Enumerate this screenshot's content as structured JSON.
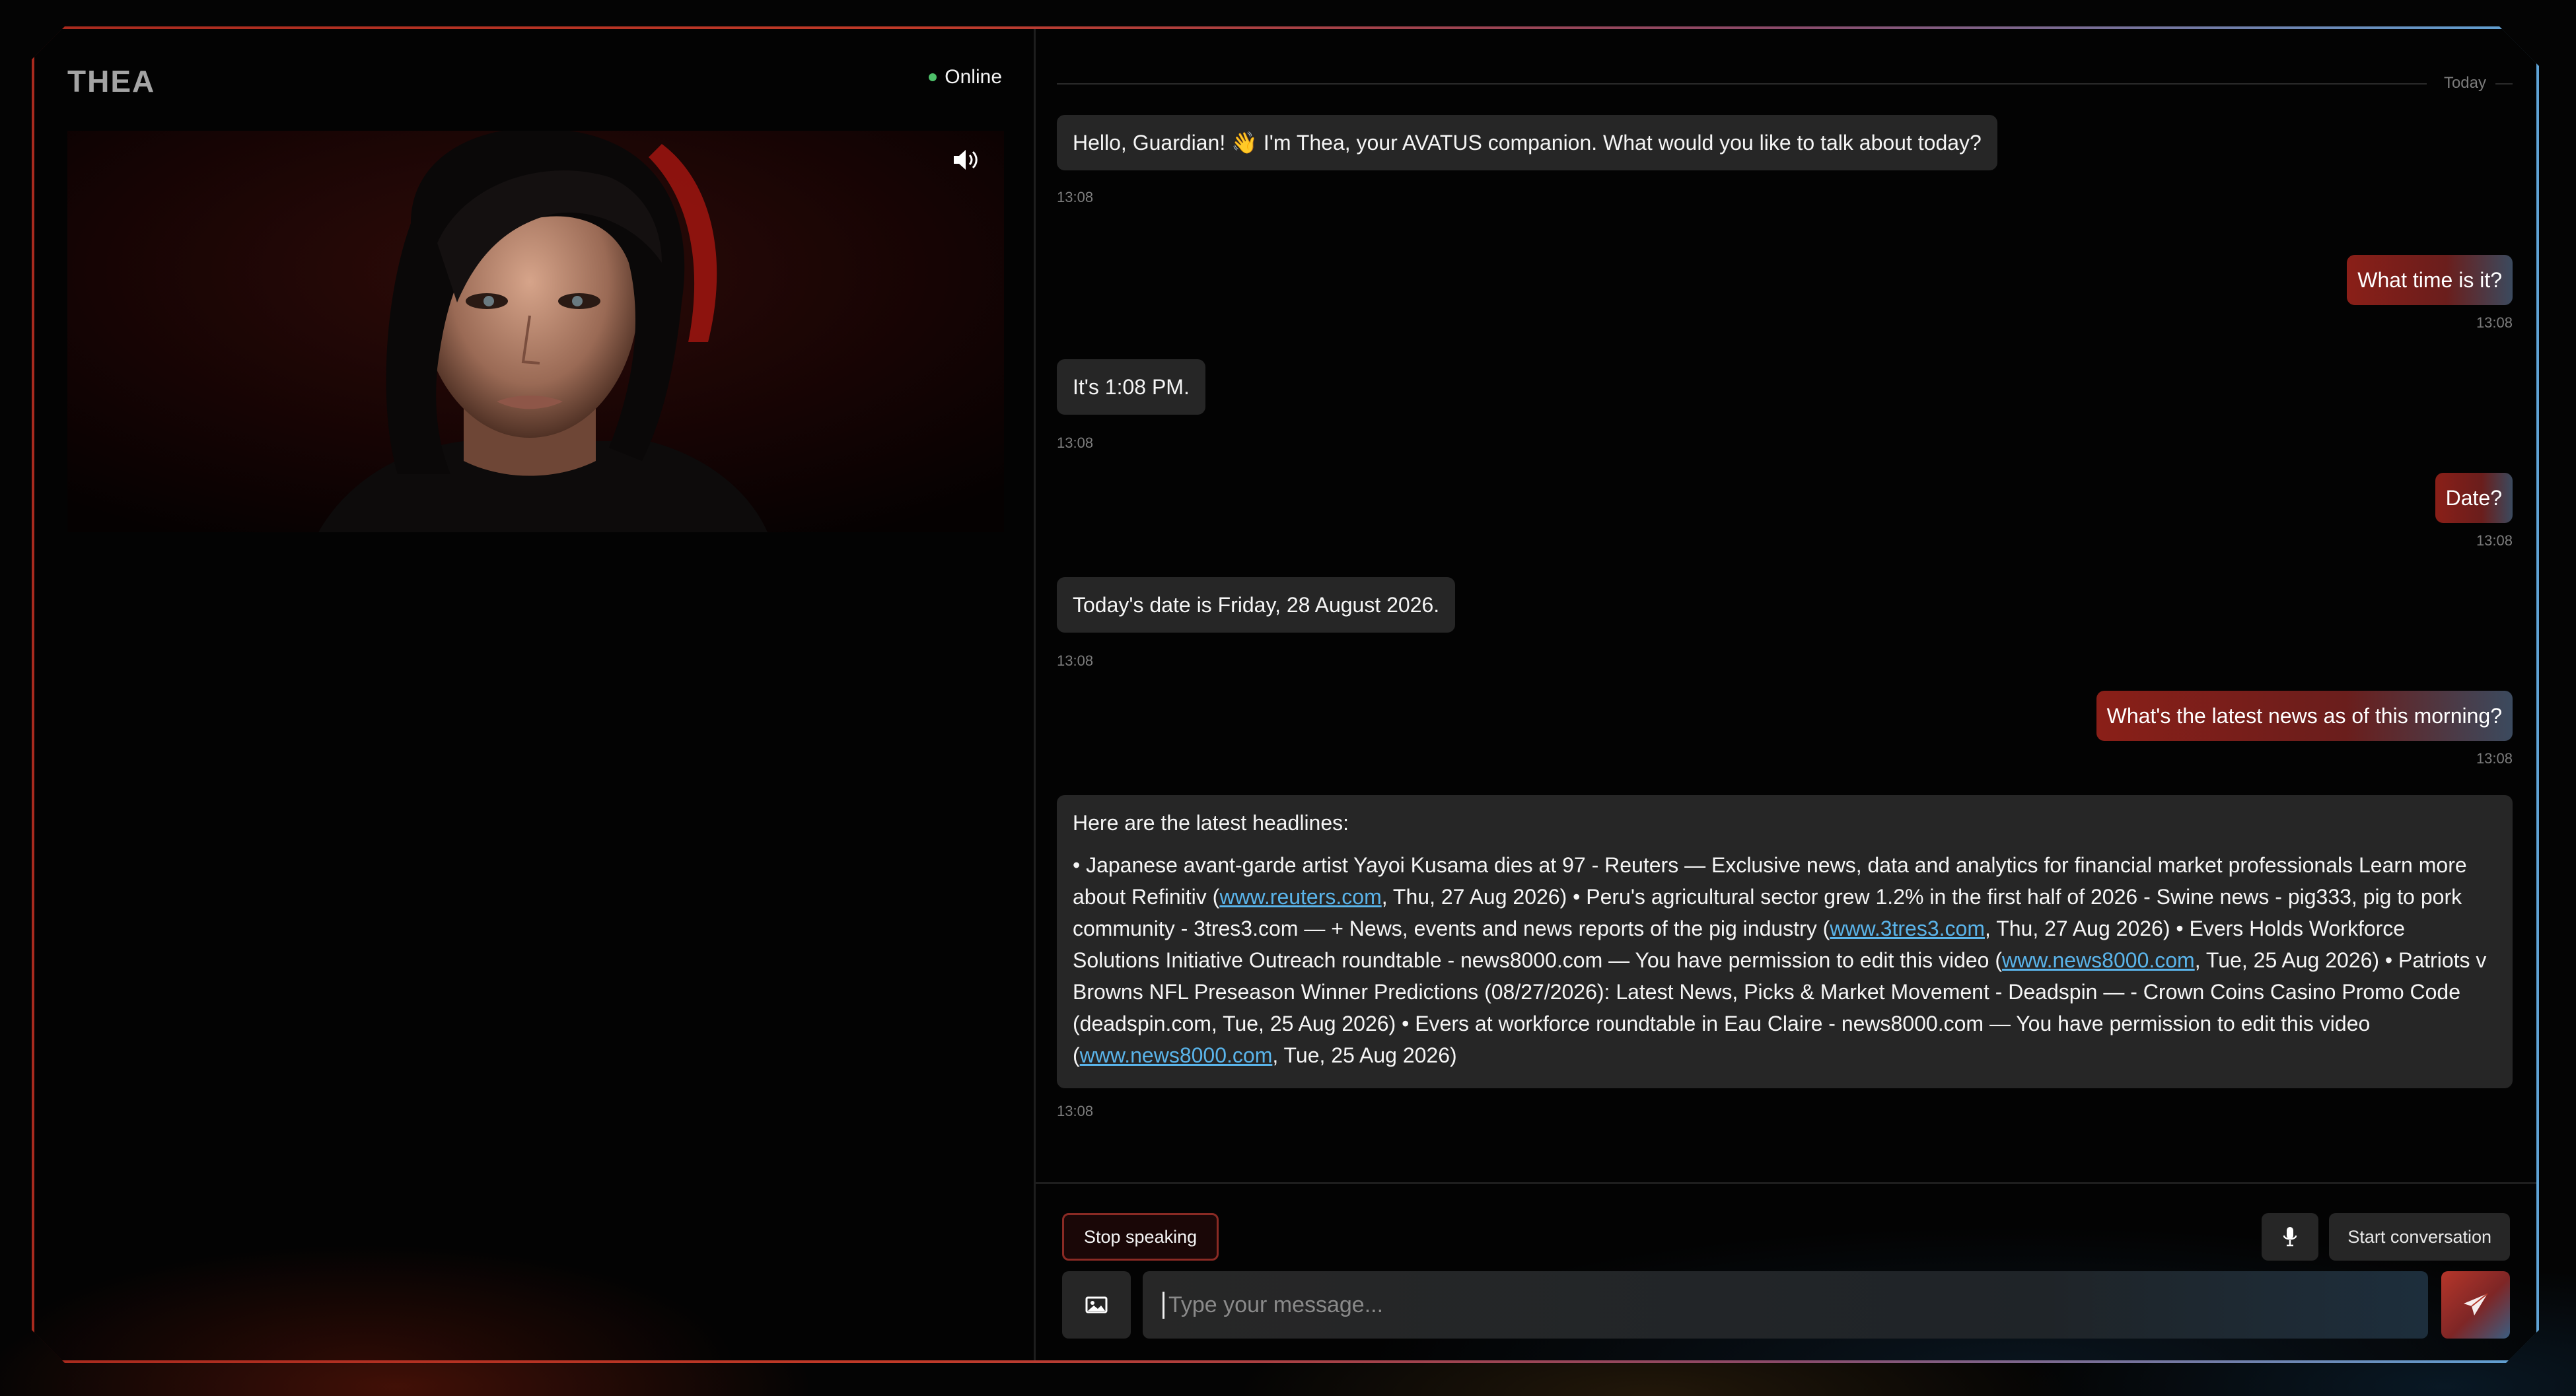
{
  "app": {
    "logo": "THEA",
    "status": "Online"
  },
  "video": {
    "volume_icon": "volume-icon"
  },
  "chat": {
    "day_label": "Today",
    "messages": [
      {
        "role": "bot",
        "text": "Hello, Guardian! 👋 I'm Thea, your AVATUS companion. What would you like to talk about today?",
        "time": "13:08"
      },
      {
        "role": "user",
        "text": "What time is it?",
        "time": "13:08"
      },
      {
        "role": "bot",
        "text": "It's 1:08 PM.",
        "time": "13:08"
      },
      {
        "role": "user",
        "text": "Date?",
        "time": "13:08"
      },
      {
        "role": "bot",
        "text": "Today's date is Friday, 28 August 2026.",
        "time": "13:08"
      },
      {
        "role": "user",
        "text": "What's the latest news as of this morning?",
        "time": "13:08"
      },
      {
        "role": "bot",
        "time": "13:08",
        "title": "Here are the latest headlines:",
        "parts": [
          "• Japanese avant-garde artist Yayoi Kusama dies at 97 - Reuters — Exclusive news, data and analytics for financial market professionals Learn more about Refinitiv (",
          "www.reuters.com",
          ", Thu, 27 Aug 2026) • Peru's agricultural sector grew 1.2% in the first half of 2026 - Swine news - pig333, pig to pork community - 3tres3.com — + News, events and news reports of the pig industry (",
          "www.3tres3.com",
          ", Thu, 27 Aug 2026) • Evers Holds Workforce Solutions Initiative Outreach roundtable - news8000.com — You have permission to edit this video (",
          "www.news8000.com",
          ", Tue, 25 Aug 2026) • Patriots v Browns NFL Preseason Winner Predictions (08/27/2026): Latest News, Picks & Market Movement - Deadspin — - Crown Coins Casino Promo Code (deadspin.com, Tue, 25 Aug 2026) • Evers at workforce roundtable in Eau Claire - news8000.com — You have permission to edit this video (",
          "www.news8000.com",
          ", Tue, 25 Aug 2026)"
        ]
      }
    ]
  },
  "composer": {
    "stop_label": "Stop speaking",
    "start_label": "Start conversation",
    "placeholder": "Type your message..."
  },
  "colors": {
    "accent_red": "#8a1f18",
    "link": "#5ab4ea",
    "online": "#4ec06a"
  }
}
